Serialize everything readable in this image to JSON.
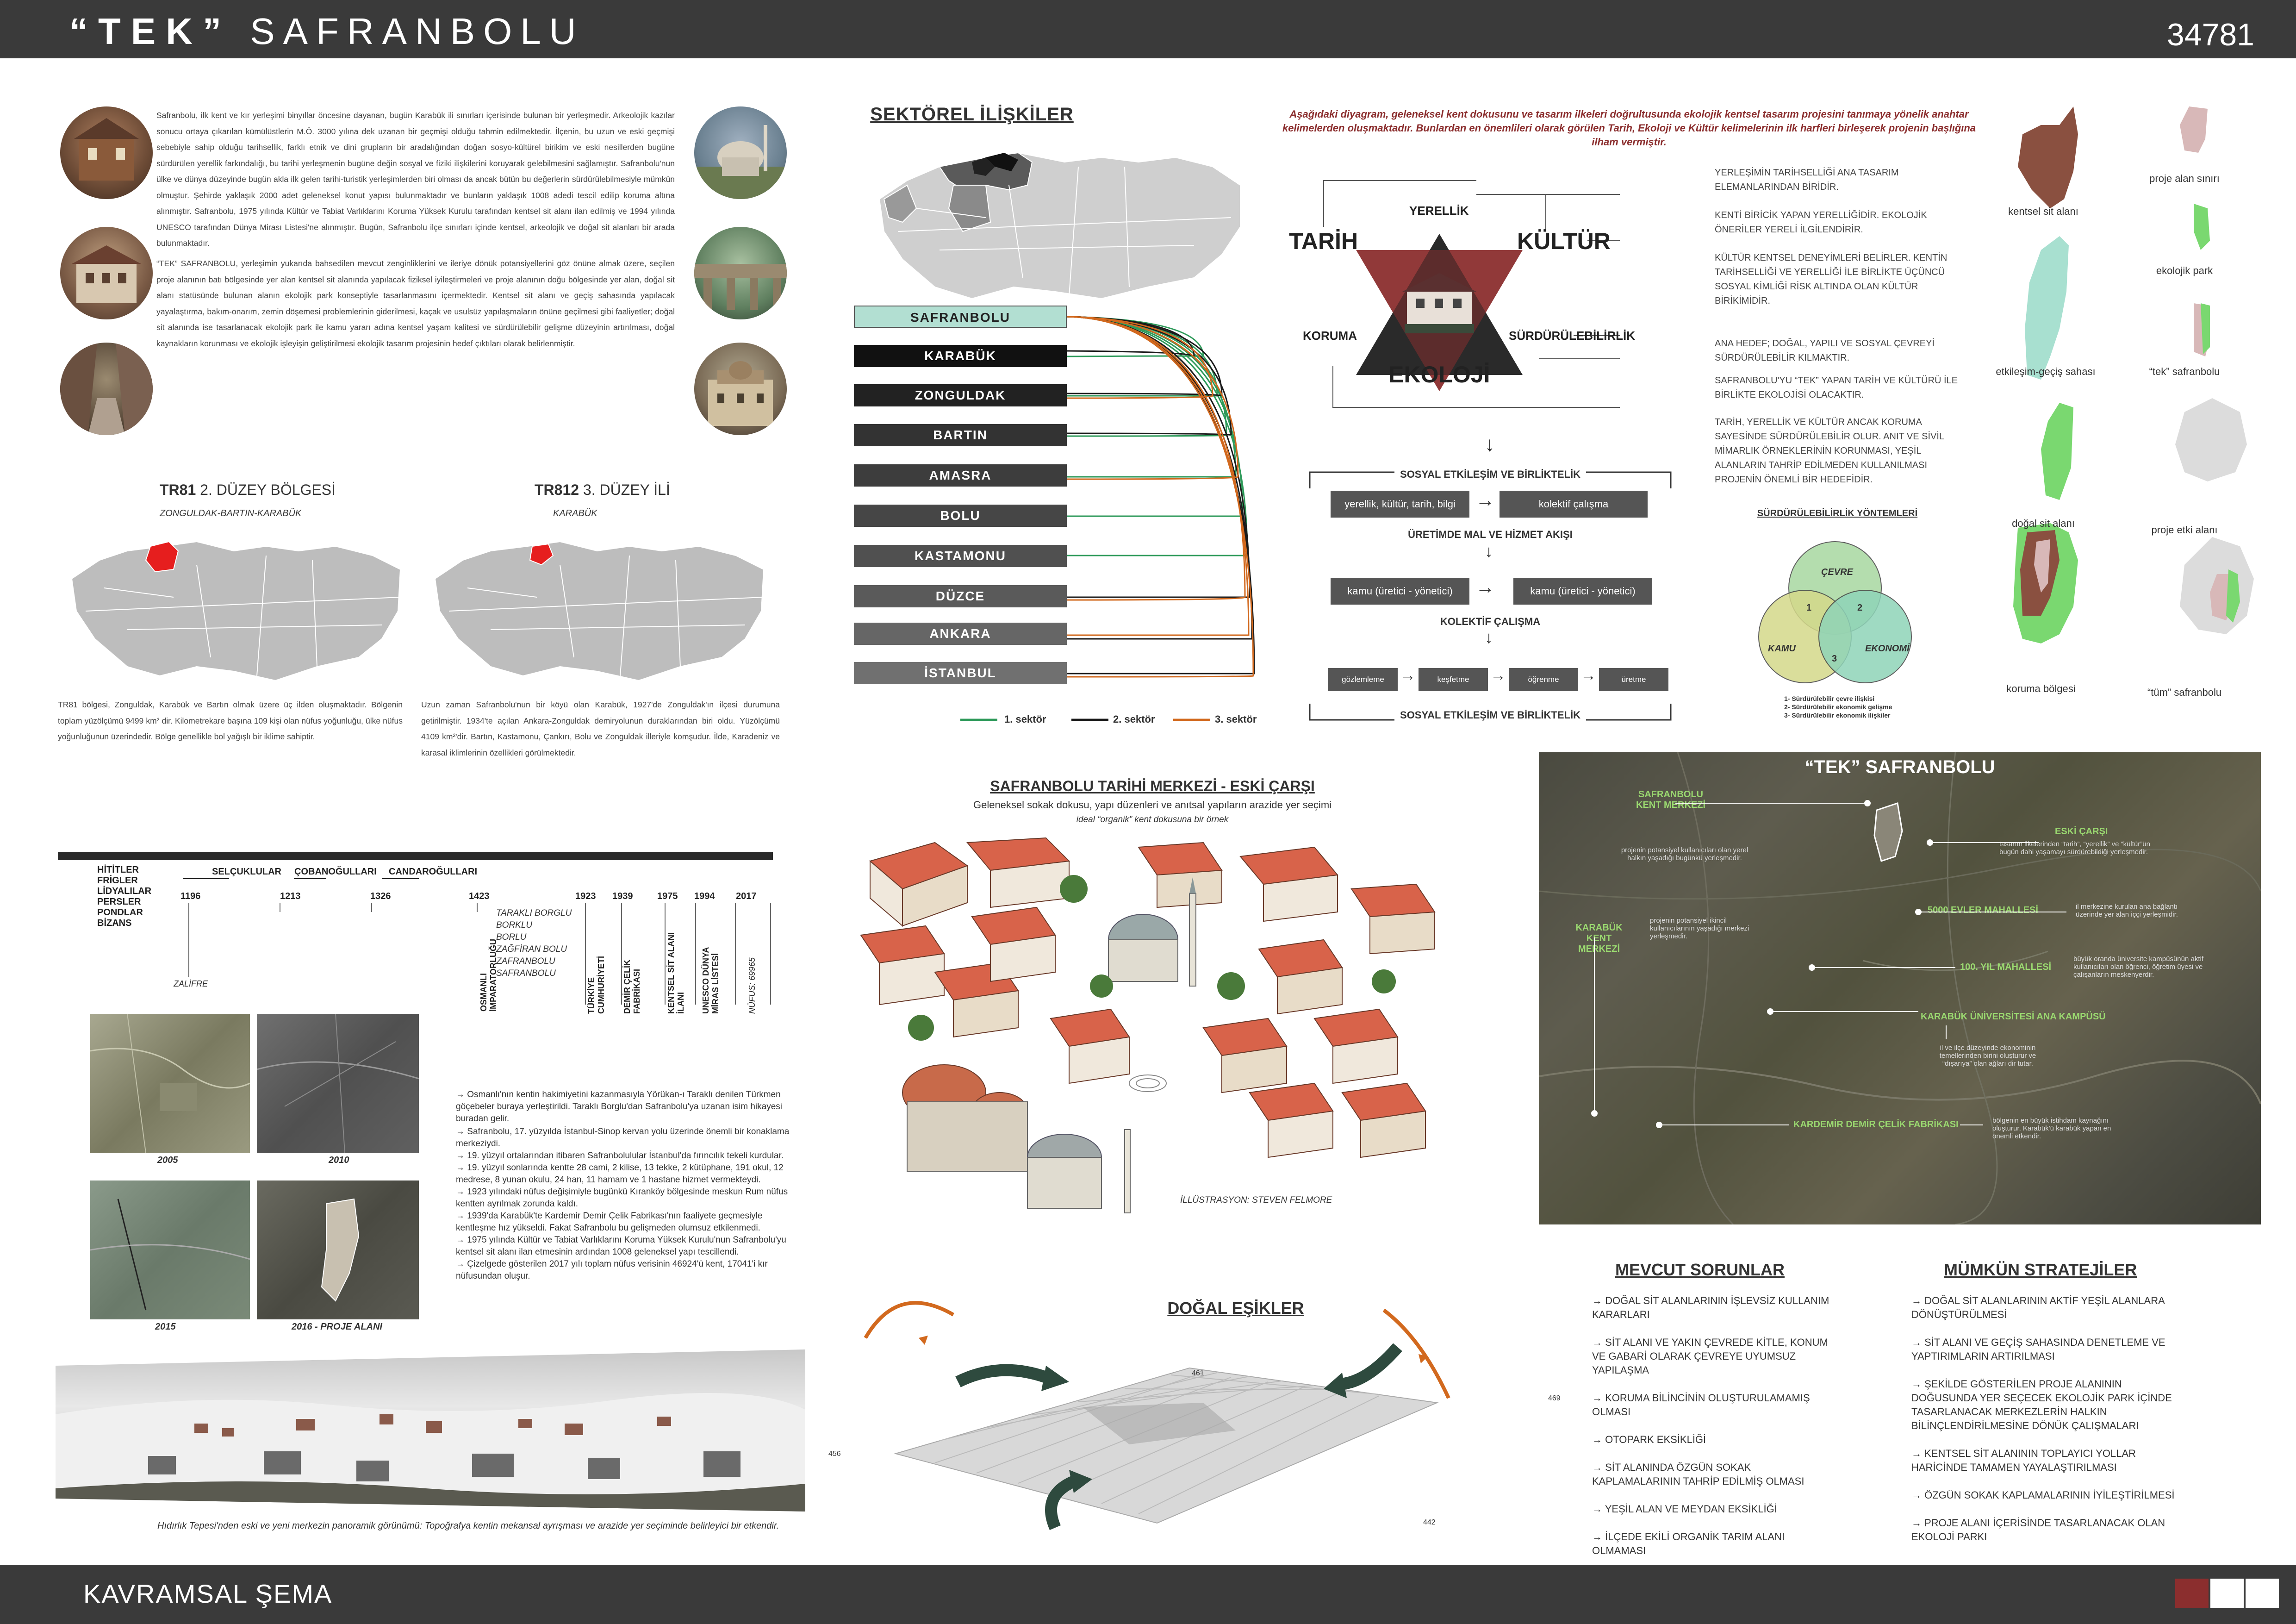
{
  "header": {
    "title_bold": "“TEK”",
    "title_rest": " SAFRANBOLU",
    "code": "34781"
  },
  "footer": {
    "title": "KAVRAMSAL ŞEMA",
    "swatches": [
      "#8b2e2e",
      "#ffffff",
      "#ffffff"
    ]
  },
  "intro": {
    "paragraph1": "Safranbolu, ilk kent ve kır yerleşimi binyıllar öncesine dayanan, bugün Karabük ili sınırları içerisinde bulunan bir yerleşmedir. Arkeolojik kazılar sonucu ortaya çıkarılan kümülüstlerin M.Ö. 3000 yılına dek uzanan bir geçmişi olduğu tahmin edilmektedir. İlçenin, bu uzun ve eski geçmişi sebebiyle sahip olduğu tarihsellik, farklı etnik ve dini grupların bir aradalığından doğan sosyo-kültürel birikim ve eski nesillerden bugüne sürdürülen yerellik farkındalığı, bu tarihi yerleşmenin bugüne değin sosyal ve fiziki ilişkilerini koruyarak gelebilmesini sağlamıştır. Safranbolu'nun ülke ve dünya düzeyinde bugün akla ilk gelen tarihi-turistik yerleşimlerden biri olması da ancak bütün bu değerlerin sürdürülebilmesiyle mümkün olmuştur. Şehirde yaklaşık 2000 adet geleneksel konut yapısı bulunmaktadır ve bunların yaklaşık 1008 adedi tescil edilip koruma altına alınmıştır. Safranbolu, 1975 yılında Kültür ve Tabiat Varlıklarını Koruma Yüksek Kurulu tarafından kentsel sit alanı ilan edilmiş ve 1994 yılında UNESCO tarafından Dünya Mirası Listesi'ne alınmıştır. Bugün, Safranbolu ilçe sınırları içinde kentsel, arkeolojik ve doğal sit alanları bir arada bulunmaktadır.",
    "paragraph2": "“TEK” SAFRANBOLU, yerleşimin yukarıda bahsedilen mevcut zenginliklerini ve ileriye dönük potansiyellerini göz önüne almak üzere, seçilen proje alanının batı bölgesinde yer alan kentsel sit alanında yapılacak fiziksel iyileştirmeleri ve proje alanının doğu bölgesinde yer alan, doğal sit alanı statüsünde bulunan alanın ekolojik park konseptiyle tasarlanmasını içermektedir. Kentsel sit alanı ve geçiş sahasında yapılacak yayalaştırma, bakım-onarım, zemin döşemesi problemlerinin giderilmesi, kaçak ve usulsüz yapılaşmaların önüne geçilmesi gibi faaliyetler; doğal sit alanında ise tasarlanacak ekolojik park ile kamu yararı adına kentsel yaşam kalitesi ve sürdürülebilir gelişme düzeyinin artırılması, doğal kaynakların korunması ve ekolojik işleyişin geliştirilmesi ekolojik tasarım projesinin hedef çıktıları olarak belirlenmiştir."
  },
  "regions": {
    "tr81_code": "TR81",
    "tr81_title": "2. DÜZEY BÖLGESİ",
    "tr81_sub": "ZONGULDAK-BARTIN-KARABÜK",
    "tr812_code": "TR812",
    "tr812_title": "3. DÜZEY İLİ",
    "tr812_sub": "KARABÜK",
    "text_left": "TR81 bölgesi, Zonguldak, Karabük ve Bartın olmak üzere üç ilden oluşmaktadır. Bölgenin toplam yüzölçümü 9499 km² dir. Kilometrekare başına 109 kişi olan nüfus yoğunluğu, ülke nüfus yoğunluğunun üzerindedir. Bölge genellikle bol yağışlı bir iklime sahiptir.",
    "text_right": "Uzun zaman Safranbolu'nun bir köyü olan Karabük, 1927'de Zonguldak'ın ilçesi durumuna getirilmiştir. 1934'te açılan Ankara-Zonguldak demiryolunun duraklarından biri oldu. Yüzölçümü 4109 km²'dir. Bartın, Kastamonu, Çankırı, Bolu ve Zonguldak illeriyle komşudur. İlde, Karadeniz ve karasal iklimlerinin özellikleri görülmektedir."
  },
  "timeline": {
    "periods": [
      "HİTİTLER",
      "FRİGLER",
      "LİDYALILAR",
      "PERSLER",
      "PONDLAR",
      "BİZANS"
    ],
    "eras": [
      "SELÇUKLULAR",
      "ÇOBANOĞULLARI",
      "CANDAROĞULLARI"
    ],
    "years": [
      "1196",
      "1213",
      "1326",
      "1423",
      "1923",
      "1939",
      "1975",
      "1994",
      "2017"
    ],
    "zalifre": "ZALİFRE",
    "names": [
      "TARAKLI BORGLU",
      "BORKLU",
      "BORLU",
      "ZAĞFİRAN BOLU",
      "ZAFRANBOLU",
      "SAFRANBOLU"
    ],
    "vertical": [
      "OSMANLI İMPARATORLUĞU",
      "TÜRKİYE CUMHURİYETİ",
      "DEMİR ÇELİK FABRİKASI",
      "KENTSEL SİT ALANI İLANI",
      "UNESCO DÜNYA MİRAS LİSTESİ"
    ],
    "nufus": "NÜFUS: 69965"
  },
  "satellite_labels": [
    "2005",
    "2010",
    "2015",
    "2016 - PROJE ALANI"
  ],
  "history_notes": [
    "Osmanlı'nın kentin hakimiyetini kazanmasıyla Yörükan-ı Taraklı denilen Türkmen göçebeler buraya yerleştirildi. Taraklı Borglu'dan Safranbolu'ya uzanan isim hikayesi buradan gelir.",
    "Safranbolu, 17. yüzyılda İstanbul-Sinop kervan yolu üzerinde önemli bir konaklama merkeziydi.",
    "19. yüzyıl ortalarından itibaren Safranbolulular İstanbul'da fırıncılık tekeli kurdular.",
    "19. yüzyıl sonlarında kentte 28 cami, 2 kilise, 13 tekke, 2 kütüphane, 191 okul, 12 medrese, 8 yunan okulu, 24 han, 11 hamam ve 1 hastane hizmet vermekteydi.",
    "1923 yılındaki nüfus değişimiyle bugünkü Kıranköy bölgesinde meskun Rum nüfus kentten ayrılmak zorunda kaldı.",
    "1939'da Karabük'te Kardemir Demir Çelik Fabrikası'nın faaliyete geçmesiyle kentleşme hız yükseldi. Fakat Safranbolu bu gelişmeden olumsuz etkilenmedi.",
    "1975 yılında Kültür ve Tabiat Varlıklarını Koruma Yüksek Kurulu'nun Safranbolu'yu kentsel sit alanı ilan etmesinin ardından 1008 geleneksel yapı tescillendi.",
    "Çizelgede gösterilen 2017 yılı toplam nüfus verisinin 46924'ü kent, 17041'i kır nüfusundan oluşur."
  ],
  "panorama_caption": "Hıdırlık Tepesi'nden eski ve yeni merkezin panoramik görünümü: Topoğrafya kentin mekansal ayrışması ve arazide yer seçiminde belirleyici bir etkendir.",
  "sectoral": {
    "title": "SEKTÖREL İLİŞKİLER",
    "cities": [
      "SAFRANBOLU",
      "KARABÜK",
      "ZONGULDAK",
      "BARTIN",
      "AMASRA",
      "BOLU",
      "KASTAMONU",
      "DÜZCE",
      "ANKARA",
      "İSTANBUL"
    ],
    "legend": [
      "1. sektör",
      "2. sektör",
      "3. sektör"
    ],
    "legend_colors": [
      "#2e9a5a",
      "#1a1a1a",
      "#d2691e"
    ]
  },
  "concept": {
    "intro": "Aşağıdaki diyagram, geleneksel kent dokusunu ve tasarım ilkeleri doğrultusunda ekolojik kentsel tasarım projesini tanımaya yönelik anahtar kelimelerden oluşmaktadır. Bunlardan en önemlileri olarak görülen Tarih, Ekoloji ve Kültür kelimelerinin ilk harfleri birleşerek projenin başlığına ilham vermiştir.",
    "tarih": "TARİH",
    "kultur": "KÜLTÜR",
    "ekoloji": "EKOLOJİ",
    "yerellik": "YERELLİK",
    "koruma": "KORUMA",
    "surdurulebilirlik": "SÜRDÜRÜLEBİLİRLİK",
    "notes": [
      "YERLEŞİMİN TARİHSELLİĞİ ANA TASARIM ELEMANLARINDAN BİRİDİR.",
      "KENTİ BİRİCİK YAPAN YERELLİĞİDİR. EKOLOJİK ÖNERİLER YERELİ İLGİLENDİRİR.",
      "KÜLTÜR KENTSEL DENEYİMLERİ BELİRLER. KENTİN TARİHSELLİĞİ VE YERELLİĞİ İLE BİRLİKTE ÜÇÜNCÜ SOSYAL KİMLİĞİ RİSK ALTINDA OLAN KÜLTÜR BİRİKİMİDİR.",
      "ANA HEDEF; DOĞAL, YAPILI VE SOSYAL ÇEVREYİ SÜRDÜRÜLEBİLİR KILMAKTIR.",
      "SAFRANBOLU'YU “TEK” YAPAN TARİH VE KÜLTÜRÜ İLE BİRLİKTE EKOLOJİSİ OLACAKTIR.",
      "TARİH, YERELLİK VE KÜLTÜR ANCAK KORUMA SAYESİNDE SÜRDÜRÜLEBİLİR OLUR. ANIT VE SİVİL MİMARLIK ÖRNEKLERİNİN KORUNMASI, YEŞİL ALANLARIN TAHRİP EDİLMEDEN KULLANILMASI PROJENİN ÖNEMLİ BİR HEDEFİDİR."
    ]
  },
  "social_diagram": {
    "top": "SOSYAL ETKİLEŞİM VE BİRLİKTELİK",
    "box1": "yerellik, kültür, tarih, bilgi",
    "box2": "kolektif çalışma",
    "mid1": "ÜRETİMDE MAL VE HİZMET AKIŞI",
    "box3": "kamu (üretici - yönetici)",
    "box4": "kamu (üretici - yönetici)",
    "mid2": "KOLEKTİF ÇALIŞMA",
    "steps": [
      "gözlemleme",
      "keşfetme",
      "öğrenme",
      "üretme"
    ],
    "bottom": "SOSYAL ETKİLEŞİM VE BİRLİKTELİK"
  },
  "venn": {
    "title": "SÜRDÜRÜLEBİLİRLİK YÖNTEMLERİ",
    "cevre": "ÇEVRE",
    "kamu": "KAMU",
    "ekonomi": "EKONOMİ",
    "n1": "1",
    "n2": "2",
    "n3": "3",
    "legend": [
      "1- Sürdürülebilir çevre ilişkisi",
      "2- Sürdürülebilir ekonomik gelişme",
      "3- Sürdürülebilir ekonomik ilişkiler"
    ],
    "colors": {
      "cevre": "#a8d8a0",
      "kamu": "#d4d98a",
      "ekonomi": "#8fd4b8"
    }
  },
  "map_legend": [
    "kentsel sit alanı",
    "proje alan sınırı",
    "ekolojik park",
    "etkileşim-geçiş sahası",
    "“tek” safranbolu",
    "doğal sit alanı",
    "proje etki alanı",
    "koruma bölgesi",
    "“tüm” safranbolu"
  ],
  "old_bazaar": {
    "title": "SAFRANBOLU TARİHİ MERKEZİ - ESKİ ÇARŞI",
    "sub": "Geleneksel sokak dokusu, yapı düzenleri ve anıtsal yapıların arazide yer seçimi",
    "sub2": "ideal “organik” kent dokusuna bir örnek",
    "credit": "İLLÜSTRASYON: STEVEN FELMORE"
  },
  "tek_map": {
    "title": "“TEK” SAFRANBOLU",
    "labels": [
      "SAFRANBOLU KENT MERKEZİ",
      "ESKİ ÇARŞI",
      "KARABÜK KENT MERKEZİ",
      "5000 EVLER MAHALLESİ",
      "100. YIL MAHALLESİ",
      "KARABÜK ÜNİVERSİTESİ ANA KAMPÜSÜ",
      "KARDEMİR DEMİR ÇELİK FABRİKASI"
    ],
    "notes": [
      "projenin potansiyel kullanıcıları olan yerel halkın yaşadığı bugünkü yerleşmedir.",
      "tasarım ilkelerinden “tarih”, “yerellik” ve “kültür”ün bugün dahi yaşamayı sürdürebildiği yerleşmedir.",
      "projenin potansiyel ikincil kullanıcılarının yaşadığı merkezi yerleşmedir.",
      "il merkezine kurulan ana bağlantı üzerinde yer alan iççi yerleşmidir.",
      "büyük oranda üniversite kampüsünün aktif kullanıcıları olan öğrenci, öğretim üyesi ve çalışanların meskenyerdir.",
      "il ve ilçe düzeyinde ekonominin temellerinden birini oluşturur ve “dışarıya” olan ağları dir tutar.",
      "bölgenin en büyük istihdam kaynağını oluşturur, Karabük'ü karabük yapan en önemli etkendir."
    ]
  },
  "problems": {
    "title": "MEVCUT SORUNLAR",
    "items": [
      "DOĞAL SİT ALANLARININ İŞLEVSİZ KULLANIM KARARLARI",
      "SİT ALANI VE YAKIN ÇEVREDE KİTLE, KONUM VE GABARİ OLARAK ÇEVREYE UYUMSUZ YAPILAŞMA",
      "KORUMA BİLİNCİNİN OLUŞTURULAMAMIŞ OLMASI",
      "OTOPARK EKSİKLİĞİ",
      "SİT ALANINDA ÖZGÜN SOKAK KAPLAMALARININ TAHRİP EDİLMİŞ OLMASI",
      "YEŞİL ALAN VE MEYDAN EKSİKLİĞİ",
      "İLÇEDE EKİLİ ORGANİK TARIM ALANI OLMAMASI"
    ]
  },
  "strategies": {
    "title": "MÜMKÜN STRATEJİLER",
    "items": [
      "DOĞAL SİT ALANLARININ AKTİF YEŞİL ALANLARA DÖNÜŞTÜRÜLMESİ",
      "SİT ALANI VE GEÇİŞ SAHASINDA DENETLEME VE YAPTIRIMLARIN ARTIRILMASI",
      "ŞEKİLDE GÖSTERİLEN PROJE ALANININ DOĞUSUNDA YER SEÇECEK EKOLOJİK PARK İÇİNDE TASARLANACAK MERKEZLERİN HALKIN BİLİNÇLENDİRİLMESİNE DÖNÜK ÇALIŞMALARI",
      "KENTSEL SİT ALANININ TOPLAYICI YOLLAR HARİCİNDE TAMAMEN YAYALAŞTIRILMASI",
      "ÖZGÜN SOKAK KAPLAMALARININ İYİLEŞTİRİLMESİ",
      "PROJE ALANI İÇERİSİNDE TASARLANACAK OLAN EKOLOJİ PARKI"
    ]
  },
  "thresholds": {
    "title": "DOĞAL EŞİKLER",
    "e1": "461",
    "e2": "469",
    "e3": "456",
    "e4": "442"
  }
}
